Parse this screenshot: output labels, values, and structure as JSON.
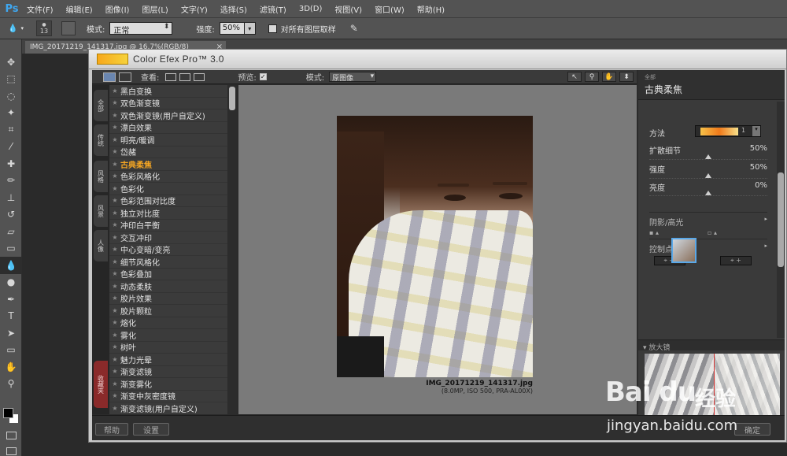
{
  "menubar": {
    "logo": "Ps",
    "items": [
      "文件(F)",
      "编辑(E)",
      "图像(I)",
      "图层(L)",
      "文字(Y)",
      "选择(S)",
      "滤镜(T)",
      "3D(D)",
      "视图(V)",
      "窗口(W)",
      "帮助(H)"
    ]
  },
  "options": {
    "brush_size": "13",
    "mode_label": "模式:",
    "mode_value": "正常",
    "strength_label": "强度:",
    "strength_value": "50%",
    "sample_all_label": "对所有图层取样"
  },
  "document_tab": {
    "title": "IMG_20171219_141317.jpg @ 16.7%(RGB/8)",
    "close": "×"
  },
  "dialog": {
    "title": "Color Efex Pro™ 3.0",
    "view_label": "查看:",
    "preview_label": "预览:",
    "preview_checked": "✓",
    "mode_label": "模式:",
    "mode_value": "原图像",
    "side_tabs": [
      "全部",
      "传统",
      "风格",
      "风景",
      "人像",
      "收藏夹"
    ],
    "filters": [
      "黑白变换",
      "双色渐变镜",
      "双色渐变镜(用户自定义)",
      "漂白效果",
      "明亮/暖调",
      "岱赭",
      "古典柔焦",
      "色彩风格化",
      "色彩化",
      "色彩范围对比度",
      "独立对比度",
      "冲印白平衡",
      "交互冲印",
      "中心变暗/变亮",
      "细节风格化",
      "色彩叠加",
      "动态柔肤",
      "胶片效果",
      "胶片颗粒",
      "熔化",
      "雾化",
      "树叶",
      "魅力光晕",
      "渐变滤镜",
      "渐变雾化",
      "渐变中灰密度镜",
      "渐变滤镜(用户自定义)"
    ],
    "selected_filter": "古典柔焦",
    "photo_filename": "IMG_20171219_141317.jpg",
    "photo_meta": "(8.0MP, ISO 500, PRA-AL00X)",
    "panel": {
      "category": "全部",
      "filter_name": "古典柔焦",
      "method_label": "方法",
      "method_num": "1",
      "diffuse_label": "扩散细节",
      "diffuse_value": "50%",
      "strength_label": "强度",
      "strength_value": "50%",
      "brightness_label": "亮度",
      "brightness_value": "0%",
      "shadows_label": "阴影/高光",
      "control_points_label": "控制点",
      "loupe_label": "放大镜"
    },
    "buttons": {
      "help": "帮助",
      "settings": "设置",
      "ok": "确定"
    }
  },
  "watermark": {
    "logo": "Bai du",
    "cn": "经验",
    "url": "jingyan.baidu.com"
  },
  "colors": {
    "accent_selected": "#f5a623",
    "ps_blue": "#3fa7f0",
    "favorites_tab": "#8a2a2a"
  },
  "sliders": {
    "diffuse": 0.5,
    "strength": 0.5,
    "brightness": 0.5
  }
}
